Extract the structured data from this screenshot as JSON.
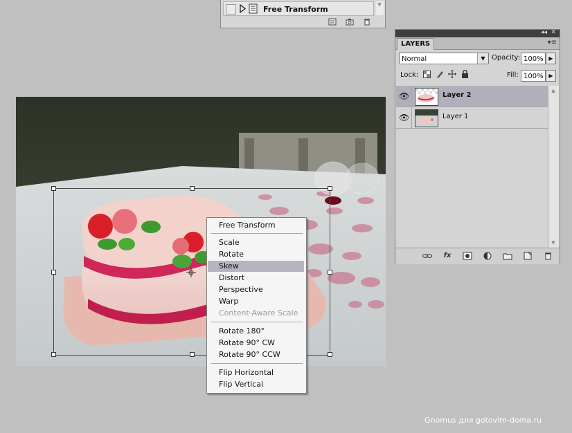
{
  "history": {
    "item_label": "Free Transform",
    "icons": [
      "snapshot-flag-icon",
      "state-icon",
      "new-document-icon",
      "camera-icon",
      "trash-icon"
    ]
  },
  "context_menu": {
    "items": [
      {
        "label": "Free Transform",
        "state": "normal"
      },
      {
        "label": "Scale",
        "state": "normal"
      },
      {
        "label": "Rotate",
        "state": "normal"
      },
      {
        "label": "Skew",
        "state": "highlighted"
      },
      {
        "label": "Distort",
        "state": "normal"
      },
      {
        "label": "Perspective",
        "state": "normal"
      },
      {
        "label": "Warp",
        "state": "normal"
      },
      {
        "label": "Content-Aware Scale",
        "state": "disabled"
      },
      {
        "label": "Rotate 180°",
        "state": "normal"
      },
      {
        "label": "Rotate 90° CW",
        "state": "normal"
      },
      {
        "label": "Rotate 90° CCW",
        "state": "normal"
      },
      {
        "label": "Flip Horizontal",
        "state": "normal"
      },
      {
        "label": "Flip Vertical",
        "state": "normal"
      }
    ]
  },
  "layers_panel": {
    "title_bar_glyphs": "◂◂ ✕",
    "tab_label": "LAYERS",
    "blend_mode": "Normal",
    "opacity_label": "Opacity:",
    "opacity_value": "100%",
    "lock_label": "Lock:",
    "fill_label": "Fill:",
    "fill_value": "100%",
    "layers": [
      {
        "name": "Layer 2",
        "visible": true,
        "selected": true
      },
      {
        "name": "Layer 1",
        "visible": true,
        "selected": false
      }
    ],
    "bottom_icons": [
      "link-layers-icon",
      "fx-icon",
      "mask-icon",
      "adjustment-icon",
      "group-folder-icon",
      "new-layer-icon",
      "trash-icon"
    ]
  },
  "canvas": {
    "description_visible": false
  },
  "credit": "Gnomus для gotovim-doma.ru",
  "colors": {
    "workspace": "#c0c0c0",
    "menu_highlight": "#b5b5c2",
    "layer_selected": "#b0b0ba"
  }
}
